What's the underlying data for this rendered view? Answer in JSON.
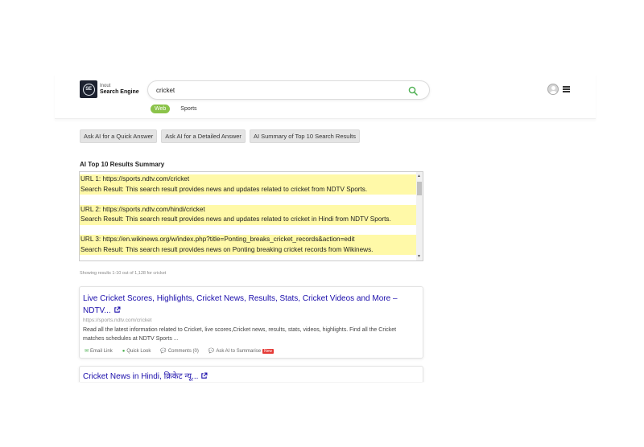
{
  "logo": {
    "mark": "SE",
    "line1": "Inout",
    "line2": "Search Engine"
  },
  "search": {
    "query": "cricket"
  },
  "tabs": [
    {
      "label": "Web",
      "active": true
    },
    {
      "label": "Sports",
      "active": false
    }
  ],
  "ai_buttons": [
    "Ask AI for a Quick Answer",
    "Ask AI for a Detailed Answer",
    "AI Summary of Top 10 Search Results"
  ],
  "summary": {
    "title": "AI Top 10 Results Summary",
    "entries": [
      {
        "url": "URL 1: https://sports.ndtv.com/cricket",
        "result": "Search Result: This search result provides news and updates related to cricket from NDTV Sports."
      },
      {
        "url": "URL 2: https://sports.ndtv.com/hindi/cricket",
        "result": "Search Result: This search result provides news and updates related to cricket in Hindi from NDTV Sports."
      },
      {
        "url": "URL 3: https://en.wikinews.org/w/index.php?title=Ponting_breaks_cricket_records&action=edit",
        "result": "Search Result: This search result provides news on Ponting breaking cricket records from Wikinews."
      }
    ]
  },
  "result_count": "Showing results 1-10 out of 1,128 for cricket",
  "results": [
    {
      "title": "Live Cricket Scores, Highlights, Cricket News, Results, Stats, Cricket Videos and More – NDTV...",
      "url": "https://sports.ndtv.com/cricket",
      "snippet": "Read all the latest information related to Cricket, live scores,Cricket news, results, stats, videos, highlights. Find all the Cricket matches schedules at NDTV Sports ...",
      "actions": {
        "email": "Email Link",
        "quick": "Quick Look",
        "comments": "Comments (0)",
        "ask_ai": "Ask AI to Summarise",
        "badge": "New"
      }
    },
    {
      "title": "Cricket News in Hindi, क्रिकेट न्यू..."
    }
  ],
  "colors": {
    "accent_green": "#8bc34a",
    "link_blue": "#1a0dab",
    "highlight": "#fff9a8"
  }
}
